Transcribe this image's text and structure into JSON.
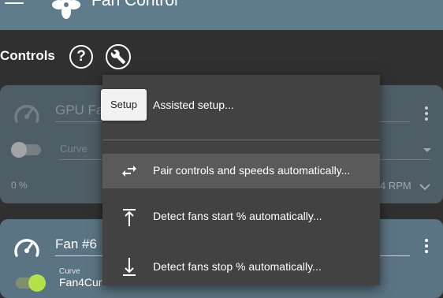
{
  "app": {
    "title": "Fan Control"
  },
  "toolbar": {
    "section_title": "Controls",
    "help_glyph": "?"
  },
  "cards": [
    {
      "name": "GPU Fa",
      "curve_placeholder": "Curve",
      "percent": "0 %",
      "rpm": "4 RPM",
      "enabled": false
    },
    {
      "name": "Fan #6",
      "curve_label": "Curve",
      "curve_value": "Fan4Cur",
      "enabled": true
    }
  ],
  "menu": {
    "tooltip": "Setup",
    "items": [
      {
        "label": "Assisted setup...",
        "icon": "none"
      },
      {
        "label": "Pair controls and speeds automatically...",
        "icon": "swap-arrows-icon"
      },
      {
        "label": "Detect fans start % automatically...",
        "icon": "arrow-up-bar-icon"
      },
      {
        "label": "Detect fans stop % automatically...",
        "icon": "arrow-down-bar-icon"
      }
    ]
  },
  "colors": {
    "appbar": "#5f7c8c",
    "background": "#303030",
    "menu": "#424242",
    "accent_toggle": "#b2e14a"
  }
}
